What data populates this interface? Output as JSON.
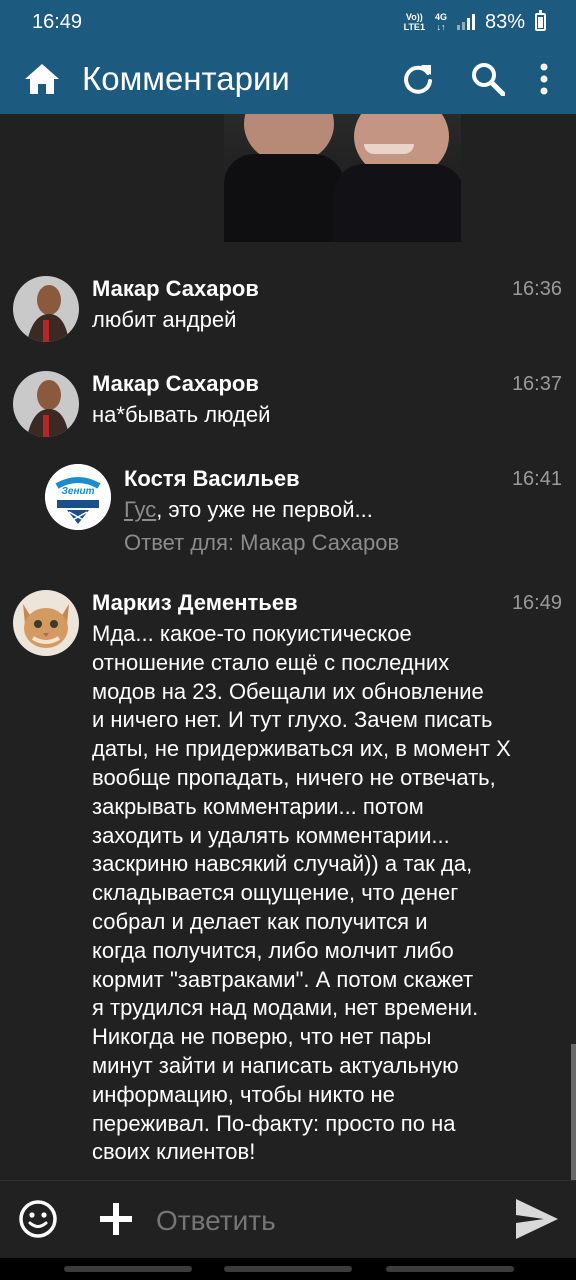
{
  "status_bar": {
    "time": "16:49",
    "volte_line1": "Vo))",
    "volte_line2": "LTE1",
    "network": "4G",
    "battery": "83%"
  },
  "app_bar": {
    "title": "Комментарии",
    "icons": [
      "home-icon",
      "refresh-icon",
      "search-icon",
      "more-vert-icon"
    ]
  },
  "comments": [
    {
      "author": "Макар Сахаров",
      "time": "16:36",
      "text": "любит андрей"
    },
    {
      "author": "Макар Сахаров",
      "time": "16:37",
      "text": "на*бывать людей"
    },
    {
      "author": "Костя Васильев",
      "time": "16:41",
      "mention": "Гус",
      "text": ", это уже не первой...",
      "reply_to": "Ответ для: Макар Сахаров",
      "avatar_logo_text": "Зенит 1925"
    },
    {
      "author": "Маркиз Дементьев",
      "time": "16:49",
      "lines": [
        "Мда... какое-то покуистическое",
        "отношение стало ещё с последних",
        "модов на 23. Обещали их обновление",
        "и ничего нет. И тут глухо. Зачем писать",
        "даты, не придерживаться их, в момент Х",
        "вообще пропадать, ничего не отвечать,",
        "закрывать комментарии... потом",
        "заходить и удалять комментарии...",
        "заскриню навсякий случай)) а так да,",
        "складывается ощущение, что денег",
        "собрал и делает как получится и",
        "когда получится, либо молчит  либо",
        "кормит \"завтраками\". А потом скажет",
        "я трудился над модами, нет времени.",
        "Никогда не поверю, что нет пары",
        "минут зайти и написать актуальную",
        "информацию,  чтобы никто не",
        "переживал. По-факту: просто по на",
        "своих клиентов!"
      ]
    }
  ],
  "compose": {
    "placeholder": "Ответить",
    "icons": [
      "emoji-icon",
      "add-icon",
      "send-icon"
    ]
  },
  "colors": {
    "app_bar": "#1d5a7f",
    "background": "#212121",
    "secondary_text": "#9a9a9a"
  }
}
